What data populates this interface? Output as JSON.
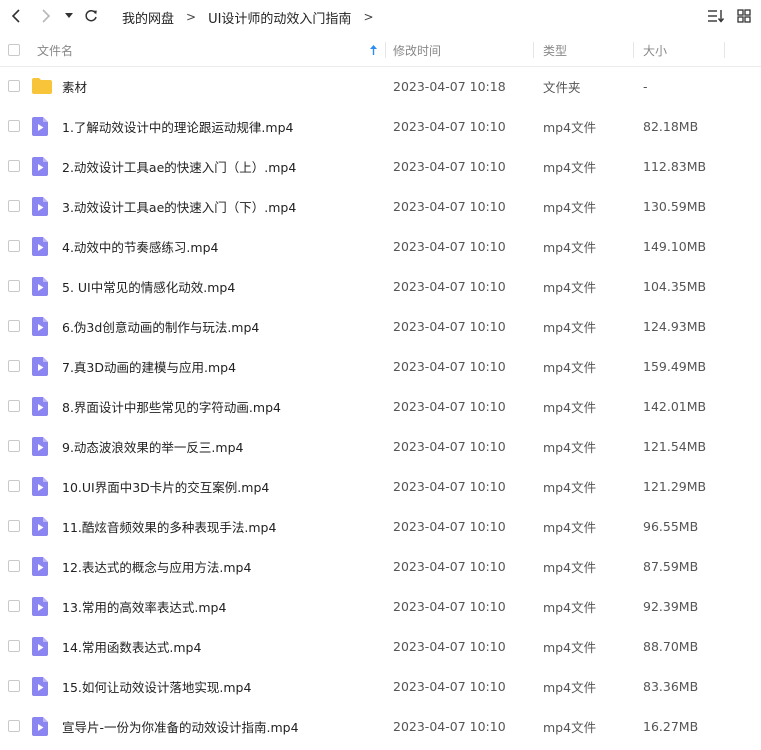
{
  "breadcrumb": {
    "items": [
      "我的网盘",
      "UI设计师的动效入门指南"
    ],
    "separator": ">"
  },
  "columns": {
    "name": "文件名",
    "modified": "修改时间",
    "type": "类型",
    "size": "大小"
  },
  "colors": {
    "folder": "#f8c53a",
    "video_icon": "#8a85f0",
    "sort_arrow": "#2d8cf0"
  },
  "files": [
    {
      "name": "素材",
      "modified": "2023-04-07 10:18",
      "type": "文件夹",
      "size": "-",
      "kind": "folder"
    },
    {
      "name": "1.了解动效设计中的理论跟运动规律.mp4",
      "modified": "2023-04-07 10:10",
      "type": "mp4文件",
      "size": "82.18MB",
      "kind": "video"
    },
    {
      "name": "2.动效设计工具ae的快速入门（上）.mp4",
      "modified": "2023-04-07 10:10",
      "type": "mp4文件",
      "size": "112.83MB",
      "kind": "video"
    },
    {
      "name": "3.动效设计工具ae的快速入门（下）.mp4",
      "modified": "2023-04-07 10:10",
      "type": "mp4文件",
      "size": "130.59MB",
      "kind": "video"
    },
    {
      "name": "4.动效中的节奏感练习.mp4",
      "modified": "2023-04-07 10:10",
      "type": "mp4文件",
      "size": "149.10MB",
      "kind": "video"
    },
    {
      "name": "5. UI中常见的情感化动效.mp4",
      "modified": "2023-04-07 10:10",
      "type": "mp4文件",
      "size": "104.35MB",
      "kind": "video"
    },
    {
      "name": "6.伪3d创意动画的制作与玩法.mp4",
      "modified": "2023-04-07 10:10",
      "type": "mp4文件",
      "size": "124.93MB",
      "kind": "video"
    },
    {
      "name": "7.真3D动画的建模与应用.mp4",
      "modified": "2023-04-07 10:10",
      "type": "mp4文件",
      "size": "159.49MB",
      "kind": "video"
    },
    {
      "name": "8.界面设计中那些常见的字符动画.mp4",
      "modified": "2023-04-07 10:10",
      "type": "mp4文件",
      "size": "142.01MB",
      "kind": "video"
    },
    {
      "name": "9.动态波浪效果的举一反三.mp4",
      "modified": "2023-04-07 10:10",
      "type": "mp4文件",
      "size": "121.54MB",
      "kind": "video"
    },
    {
      "name": "10.UI界面中3D卡片的交互案例.mp4",
      "modified": "2023-04-07 10:10",
      "type": "mp4文件",
      "size": "121.29MB",
      "kind": "video"
    },
    {
      "name": "11.酷炫音频效果的多种表现手法.mp4",
      "modified": "2023-04-07 10:10",
      "type": "mp4文件",
      "size": "96.55MB",
      "kind": "video"
    },
    {
      "name": "12.表达式的概念与应用方法.mp4",
      "modified": "2023-04-07 10:10",
      "type": "mp4文件",
      "size": "87.59MB",
      "kind": "video"
    },
    {
      "name": "13.常用的高效率表达式.mp4",
      "modified": "2023-04-07 10:10",
      "type": "mp4文件",
      "size": "92.39MB",
      "kind": "video"
    },
    {
      "name": "14.常用函数表达式.mp4",
      "modified": "2023-04-07 10:10",
      "type": "mp4文件",
      "size": "88.70MB",
      "kind": "video"
    },
    {
      "name": "15.如何让动效设计落地实现.mp4",
      "modified": "2023-04-07 10:10",
      "type": "mp4文件",
      "size": "83.36MB",
      "kind": "video"
    },
    {
      "name": "宣导片-一份为你准备的动效设计指南.mp4",
      "modified": "2023-04-07 10:10",
      "type": "mp4文件",
      "size": "16.27MB",
      "kind": "video"
    }
  ]
}
